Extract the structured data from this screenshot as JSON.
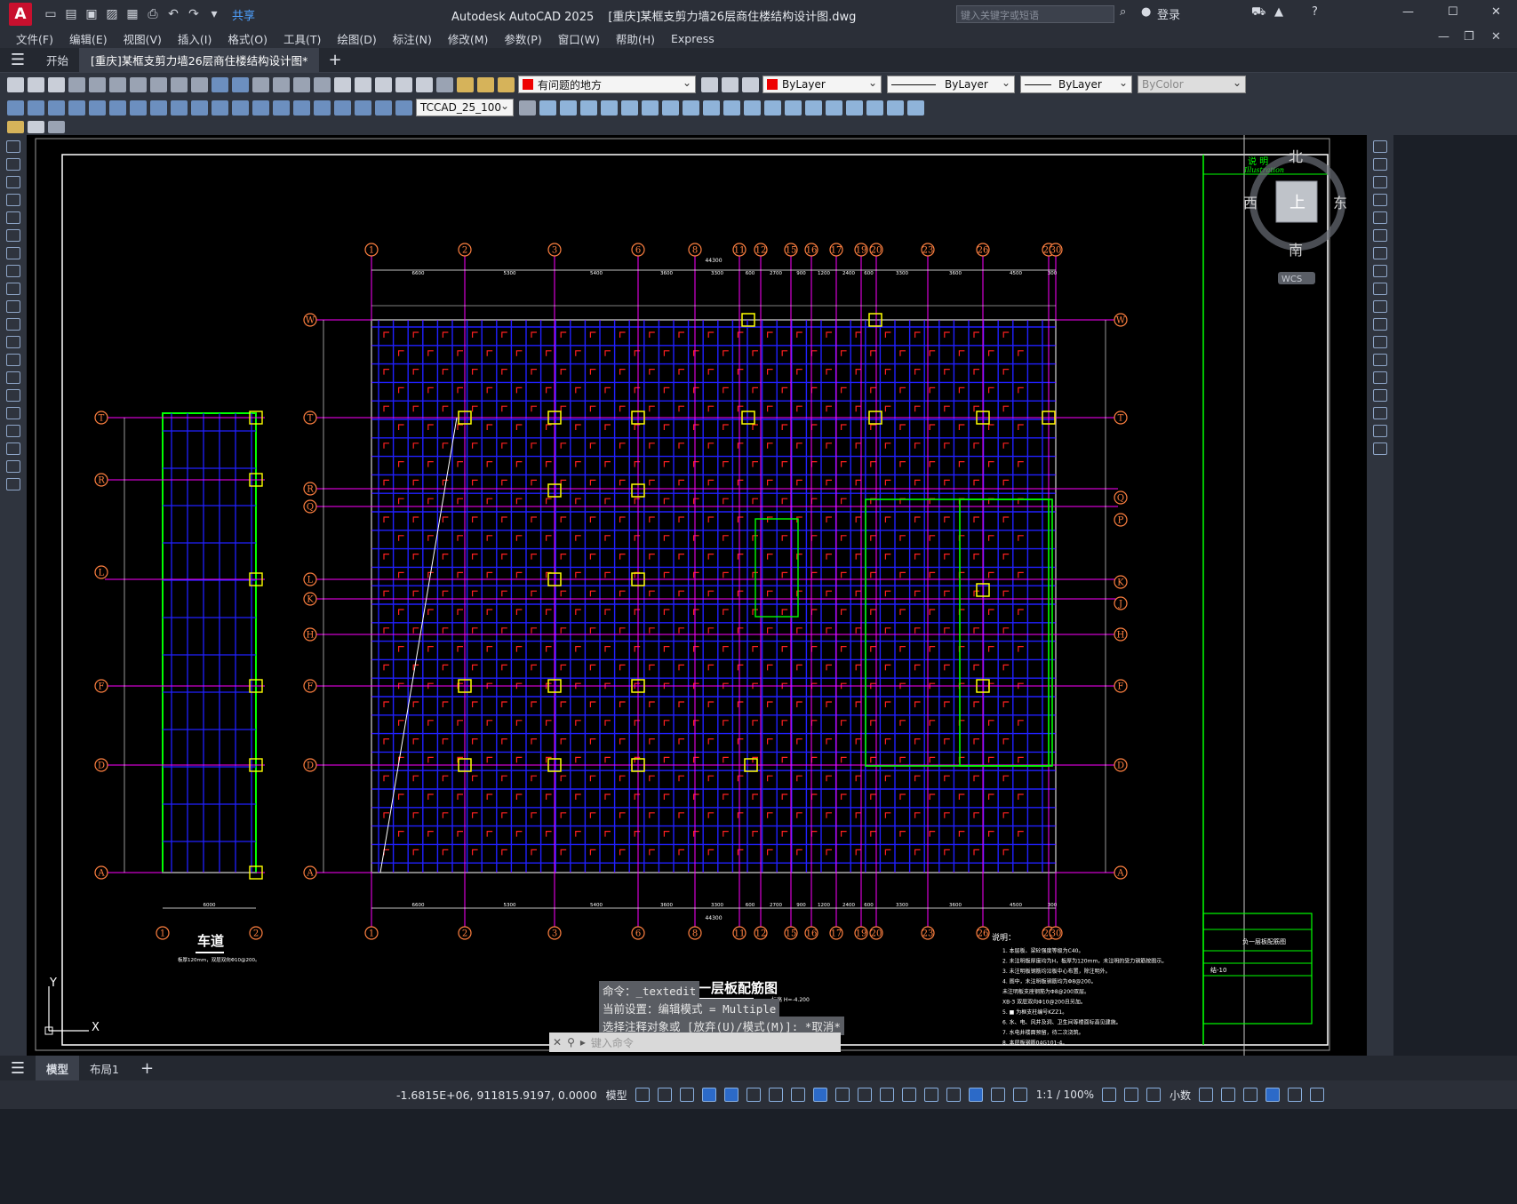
{
  "window": {
    "app_logo": "A",
    "title": "Autodesk AutoCAD 2025",
    "document_title": "[重庆]某框支剪力墙26层商住楼结构设计图.dwg",
    "search_placeholder": "键入关键字或短语",
    "share_label": "共享",
    "login_label": "登录"
  },
  "menu": [
    "文件(F)",
    "编辑(E)",
    "视图(V)",
    "插入(I)",
    "格式(O)",
    "工具(T)",
    "绘图(D)",
    "标注(N)",
    "修改(M)",
    "参数(P)",
    "窗口(W)",
    "帮助(H)",
    "Express"
  ],
  "tabs": {
    "start": "开始",
    "doc": "[重庆]某框支剪力墙26层商住楼结构设计图*",
    "plus": "+"
  },
  "toolbar": {
    "layer_name": "有问题的地方",
    "color": "ByLayer",
    "linetype": "ByLayer",
    "lineweight": "ByLayer",
    "plotstyle": "ByColor",
    "textstyle": "TCCAD_25_100"
  },
  "viewcube": {
    "north": "北",
    "south": "南",
    "east": "东",
    "west": "西",
    "top": "上",
    "wcs": "WCS"
  },
  "drawing": {
    "top_grid_labels": [
      "1",
      "2",
      "3",
      "6",
      "8",
      "11",
      "12",
      "15",
      "16",
      "17",
      "19",
      "20",
      "23",
      "26",
      "29",
      "30"
    ],
    "row_labels_left": [
      "W",
      "T",
      "R",
      "Q",
      "L",
      "K",
      "H",
      "F",
      "D",
      "A"
    ],
    "row_labels_right": [
      "W",
      "T",
      "Q",
      "P",
      "K",
      "J",
      "H",
      "F",
      "D",
      "A"
    ],
    "aux_rows": [
      "T",
      "R",
      "L",
      "F",
      "D",
      "A"
    ],
    "aux_cols": [
      "1",
      "2"
    ],
    "top_dims": [
      "6600",
      "5300",
      "5400",
      "3600",
      "3300",
      "600",
      "2700",
      "900",
      "1200",
      "2400",
      "600",
      "3300",
      "3600",
      "4500",
      "300"
    ],
    "overall_dim": "44300",
    "aux_width": "6000",
    "aux_title": "车道",
    "aux_note": "板厚120mm，双层双向Φ10@200。",
    "plan_title": "负一层板配筋图",
    "plan_elev": "标高 H=-4.200",
    "notes_title": "说明：",
    "notes": [
      "1. 本层板、梁砼强度等级为C40。",
      "2. 未注明板厚度均为H，板厚为120mm，未注明的受力钢筋按图示。",
      "3. 未注明板钢筋均沿板中心布置，除注明外。",
      "4. 图中，未注明板钢筋均为Φ8@200。",
      "   未注明板支座钢筋为Φ8@200双层。",
      "   XB-3 双层双向Φ10@200且另加。",
      "5. ■ 为框支柱编号KZZ1。",
      "6. 水、电、风井及洞、卫生间等楼面标高见建施。",
      "7. 水电井楼面预留，待二次浇筑。",
      "8. 本层板钢筋04G101-4。"
    ],
    "titleblock_name": "负一层板配筋图",
    "titleblock_no": "结-10",
    "illustration_top": "说 明",
    "illustration_sub": "Illustration",
    "axis_y": "Y",
    "axis_x": "X"
  },
  "command": {
    "history": [
      "命令：_textedit",
      "当前设置：编辑模式 = Multiple",
      "选择注释对象或 [放弃(U)/模式(M)]: *取消*"
    ],
    "placeholder": "键入命令"
  },
  "layouts": [
    "模型",
    "布局1"
  ],
  "status": {
    "coords": "-1.6815E+06, 911815.9197, 0.0000",
    "model": "模型",
    "scale": "1:1 / 100%",
    "units": "小数"
  },
  "colors": {
    "accent": "#2c6ac8",
    "layer_color": "#e00000",
    "canvas": "#000000",
    "column": "#ffff00",
    "axis": "#ff00ff",
    "grid": "#2020ff",
    "rebar": "#ff2020",
    "bubble": "#ff8040"
  }
}
